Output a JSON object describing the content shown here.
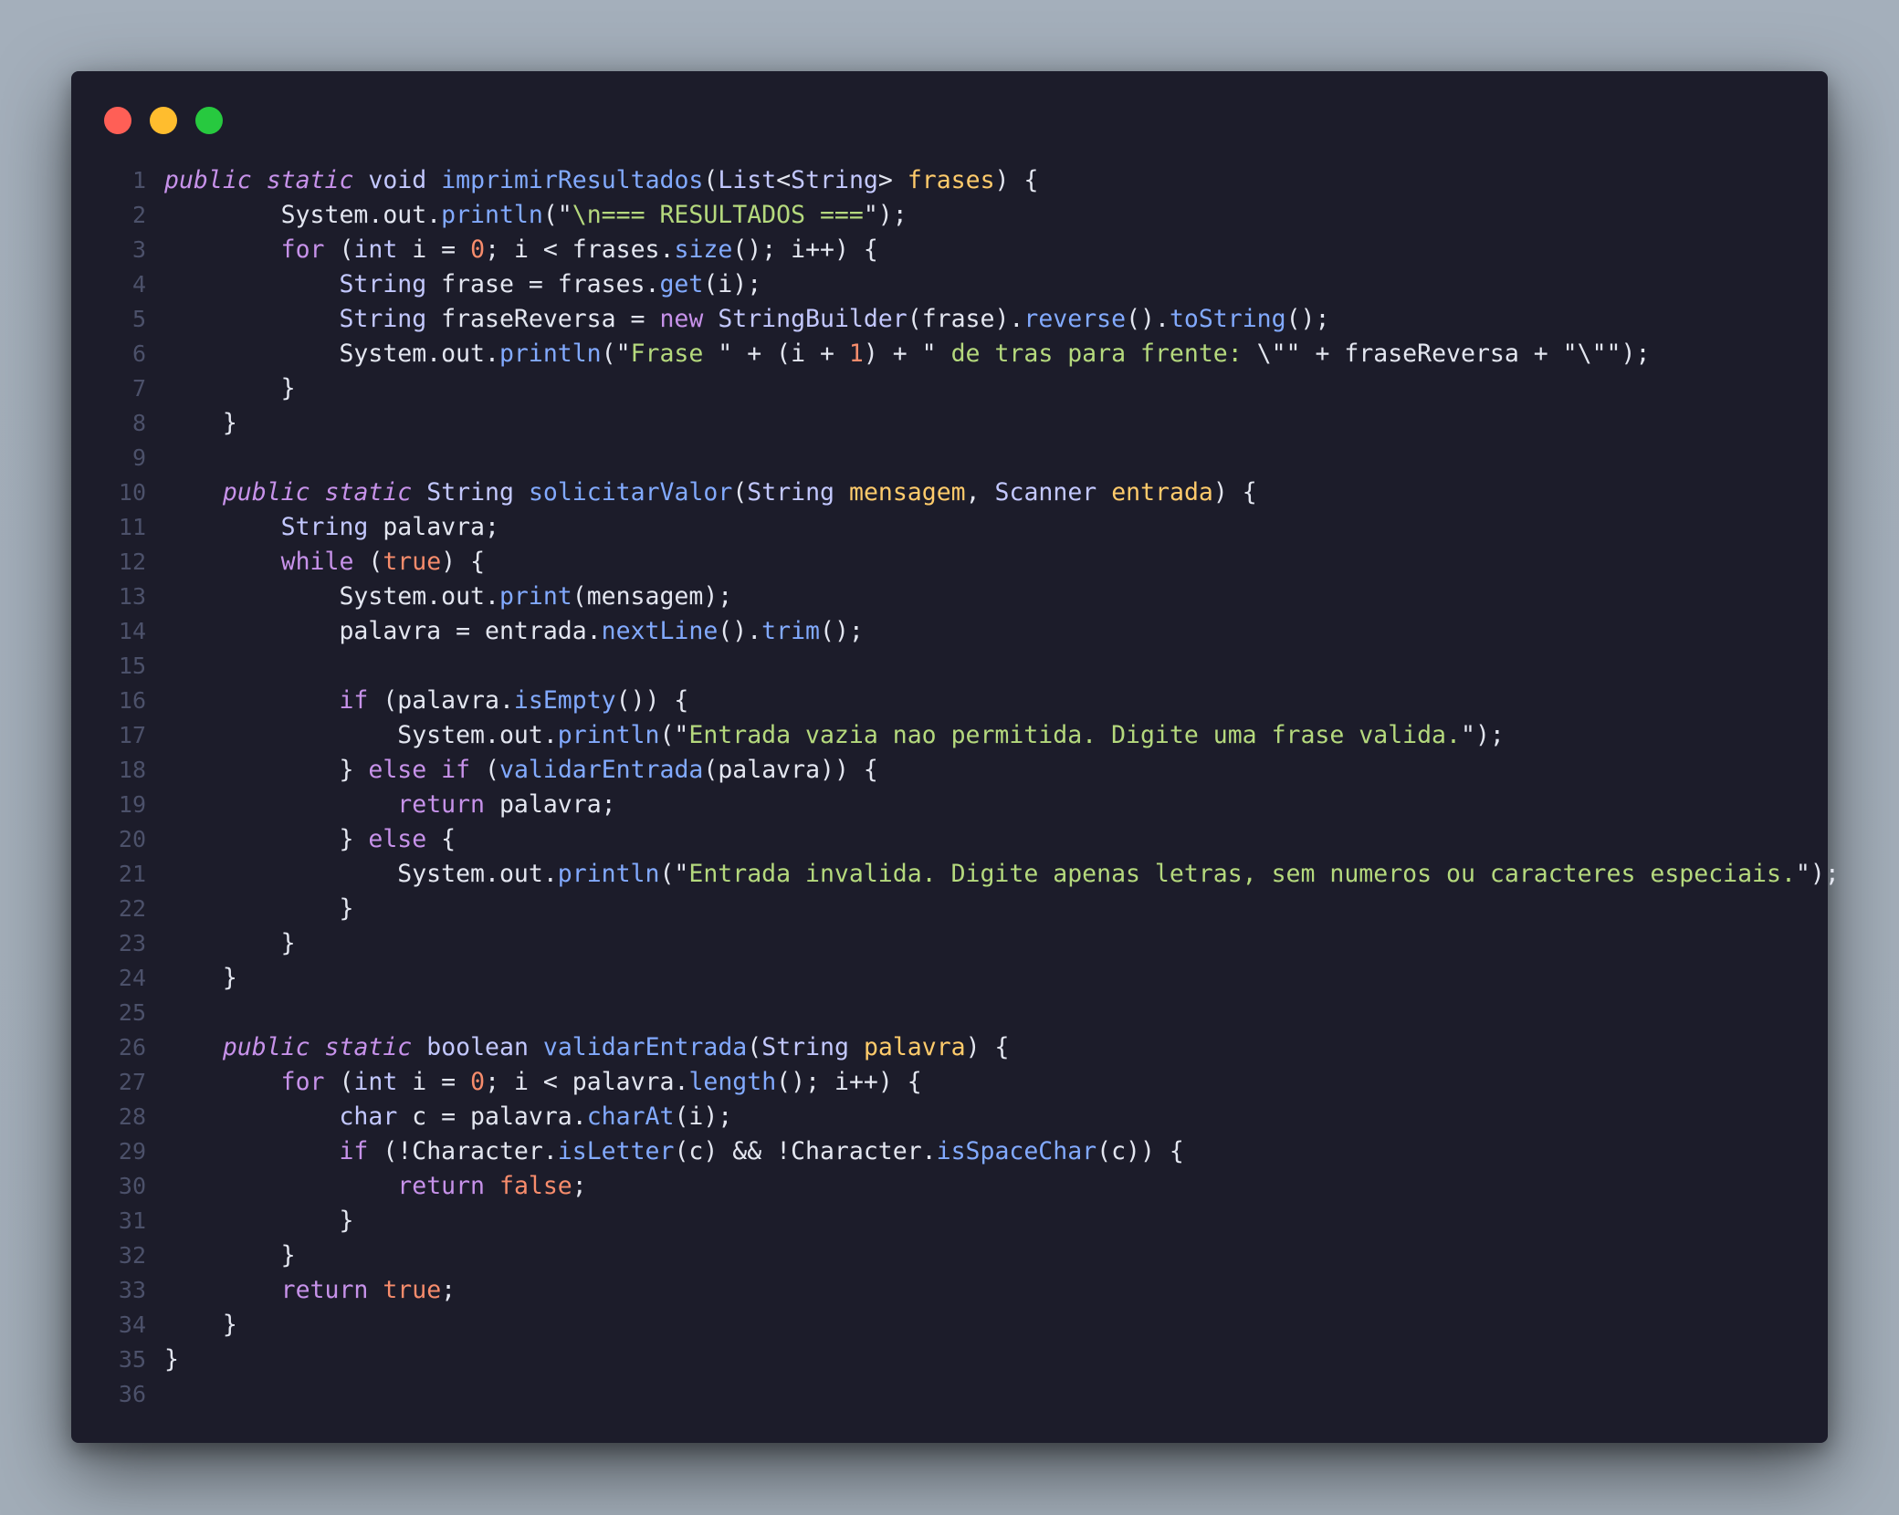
{
  "window": {
    "controls": [
      "close",
      "minimize",
      "maximize"
    ]
  },
  "code": {
    "language": "java",
    "lines": [
      [
        [
          "k it",
          "public"
        ],
        [
          "pl",
          " "
        ],
        [
          "k it",
          "static"
        ],
        [
          "pl",
          " "
        ],
        [
          "t",
          "void"
        ],
        [
          "pl",
          " "
        ],
        [
          "m",
          "imprimirResultados"
        ],
        [
          "pl",
          "("
        ],
        [
          "t",
          "List"
        ],
        [
          "pl",
          "<"
        ],
        [
          "t",
          "String"
        ],
        [
          "pl",
          "> "
        ],
        [
          "p",
          "frases"
        ],
        [
          "pl",
          ") {"
        ]
      ],
      [
        [
          "pl",
          "        System.out."
        ],
        [
          "m",
          "println"
        ],
        [
          "pl",
          "(\""
        ],
        [
          "s",
          "\\n=== RESULTADOS ==="
        ],
        [
          "pl",
          "\");"
        ]
      ],
      [
        [
          "pl",
          "        "
        ],
        [
          "k",
          "for"
        ],
        [
          "pl",
          " ("
        ],
        [
          "t",
          "int"
        ],
        [
          "pl",
          " i = "
        ],
        [
          "n",
          "0"
        ],
        [
          "pl",
          "; i < frases."
        ],
        [
          "m",
          "size"
        ],
        [
          "pl",
          "(); i++) {"
        ]
      ],
      [
        [
          "pl",
          "            "
        ],
        [
          "t",
          "String"
        ],
        [
          "pl",
          " frase = frases."
        ],
        [
          "m",
          "get"
        ],
        [
          "pl",
          "(i);"
        ]
      ],
      [
        [
          "pl",
          "            "
        ],
        [
          "t",
          "String"
        ],
        [
          "pl",
          " fraseReversa = "
        ],
        [
          "k",
          "new"
        ],
        [
          "pl",
          " "
        ],
        [
          "t",
          "StringBuilder"
        ],
        [
          "pl",
          "(frase)."
        ],
        [
          "m",
          "reverse"
        ],
        [
          "pl",
          "()."
        ],
        [
          "m",
          "toString"
        ],
        [
          "pl",
          "();"
        ]
      ],
      [
        [
          "pl",
          "            System.out."
        ],
        [
          "m",
          "println"
        ],
        [
          "pl",
          "(\""
        ],
        [
          "s",
          "Frase "
        ],
        [
          "pl",
          "\" + (i + "
        ],
        [
          "n",
          "1"
        ],
        [
          "pl",
          ") + \""
        ],
        [
          "s",
          " de tras para frente: "
        ],
        [
          "pl",
          "\\\"\" + fraseReversa + \"\\\"\");"
        ]
      ],
      [
        [
          "pl",
          "        }"
        ]
      ],
      [
        [
          "pl",
          "    }"
        ]
      ],
      [],
      [
        [
          "pl",
          "    "
        ],
        [
          "k it",
          "public"
        ],
        [
          "pl",
          " "
        ],
        [
          "k it",
          "static"
        ],
        [
          "pl",
          " "
        ],
        [
          "t",
          "String"
        ],
        [
          "pl",
          " "
        ],
        [
          "m",
          "solicitarValor"
        ],
        [
          "pl",
          "("
        ],
        [
          "t",
          "String"
        ],
        [
          "pl",
          " "
        ],
        [
          "p",
          "mensagem"
        ],
        [
          "pl",
          ", "
        ],
        [
          "t",
          "Scanner"
        ],
        [
          "pl",
          " "
        ],
        [
          "p",
          "entrada"
        ],
        [
          "pl",
          ") {"
        ]
      ],
      [
        [
          "pl",
          "        "
        ],
        [
          "t",
          "String"
        ],
        [
          "pl",
          " palavra;"
        ]
      ],
      [
        [
          "pl",
          "        "
        ],
        [
          "k",
          "while"
        ],
        [
          "pl",
          " ("
        ],
        [
          "b",
          "true"
        ],
        [
          "pl",
          ") {"
        ]
      ],
      [
        [
          "pl",
          "            System.out."
        ],
        [
          "m",
          "print"
        ],
        [
          "pl",
          "(mensagem);"
        ]
      ],
      [
        [
          "pl",
          "            palavra = entrada."
        ],
        [
          "m",
          "nextLine"
        ],
        [
          "pl",
          "()."
        ],
        [
          "m",
          "trim"
        ],
        [
          "pl",
          "();"
        ]
      ],
      [],
      [
        [
          "pl",
          "            "
        ],
        [
          "k",
          "if"
        ],
        [
          "pl",
          " (palavra."
        ],
        [
          "m",
          "isEmpty"
        ],
        [
          "pl",
          "()) {"
        ]
      ],
      [
        [
          "pl",
          "                System.out."
        ],
        [
          "m",
          "println"
        ],
        [
          "pl",
          "(\""
        ],
        [
          "s",
          "Entrada vazia nao permitida. Digite uma frase valida."
        ],
        [
          "pl",
          "\");"
        ]
      ],
      [
        [
          "pl",
          "            } "
        ],
        [
          "k",
          "else"
        ],
        [
          "pl",
          " "
        ],
        [
          "k",
          "if"
        ],
        [
          "pl",
          " ("
        ],
        [
          "m",
          "validarEntrada"
        ],
        [
          "pl",
          "(palavra)) {"
        ]
      ],
      [
        [
          "pl",
          "                "
        ],
        [
          "k",
          "return"
        ],
        [
          "pl",
          " palavra;"
        ]
      ],
      [
        [
          "pl",
          "            } "
        ],
        [
          "k",
          "else"
        ],
        [
          "pl",
          " {"
        ]
      ],
      [
        [
          "pl",
          "                System.out."
        ],
        [
          "m",
          "println"
        ],
        [
          "pl",
          "(\""
        ],
        [
          "s",
          "Entrada invalida. Digite apenas letras, sem numeros ou caracteres especiais."
        ],
        [
          "pl",
          "\");"
        ]
      ],
      [
        [
          "pl",
          "            }"
        ]
      ],
      [
        [
          "pl",
          "        }"
        ]
      ],
      [
        [
          "pl",
          "    }"
        ]
      ],
      [],
      [
        [
          "pl",
          "    "
        ],
        [
          "k it",
          "public"
        ],
        [
          "pl",
          " "
        ],
        [
          "k it",
          "static"
        ],
        [
          "pl",
          " "
        ],
        [
          "t",
          "boolean"
        ],
        [
          "pl",
          " "
        ],
        [
          "m",
          "validarEntrada"
        ],
        [
          "pl",
          "("
        ],
        [
          "t",
          "String"
        ],
        [
          "pl",
          " "
        ],
        [
          "p",
          "palavra"
        ],
        [
          "pl",
          ") {"
        ]
      ],
      [
        [
          "pl",
          "        "
        ],
        [
          "k",
          "for"
        ],
        [
          "pl",
          " ("
        ],
        [
          "t",
          "int"
        ],
        [
          "pl",
          " i = "
        ],
        [
          "n",
          "0"
        ],
        [
          "pl",
          "; i < palavra."
        ],
        [
          "m",
          "length"
        ],
        [
          "pl",
          "(); i++) {"
        ]
      ],
      [
        [
          "pl",
          "            "
        ],
        [
          "t",
          "char"
        ],
        [
          "pl",
          " c = palavra."
        ],
        [
          "m",
          "charAt"
        ],
        [
          "pl",
          "(i);"
        ]
      ],
      [
        [
          "pl",
          "            "
        ],
        [
          "k",
          "if"
        ],
        [
          "pl",
          " (!Character."
        ],
        [
          "m",
          "isLetter"
        ],
        [
          "pl",
          "(c) && !Character."
        ],
        [
          "m",
          "isSpaceChar"
        ],
        [
          "pl",
          "(c)) {"
        ]
      ],
      [
        [
          "pl",
          "                "
        ],
        [
          "k",
          "return"
        ],
        [
          "pl",
          " "
        ],
        [
          "b",
          "false"
        ],
        [
          "pl",
          ";"
        ]
      ],
      [
        [
          "pl",
          "            }"
        ]
      ],
      [
        [
          "pl",
          "        }"
        ]
      ],
      [
        [
          "pl",
          "        "
        ],
        [
          "k",
          "return"
        ],
        [
          "pl",
          " "
        ],
        [
          "b",
          "true"
        ],
        [
          "pl",
          ";"
        ]
      ],
      [
        [
          "pl",
          "    }"
        ]
      ],
      [
        [
          "pl",
          "}"
        ]
      ],
      []
    ]
  }
}
